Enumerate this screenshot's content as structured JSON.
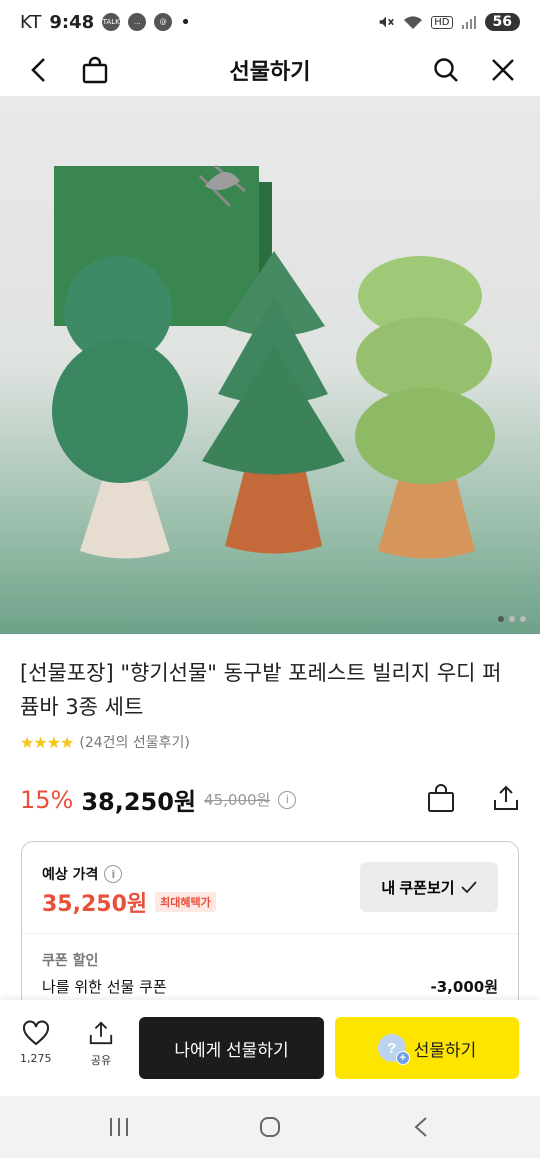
{
  "status_bar": {
    "carrier": "KT",
    "time": "9:48",
    "notif_talk": "TALK",
    "battery": "56"
  },
  "header": {
    "title": "선물하기"
  },
  "product": {
    "name": "[선물포장] \"향기선물\" 동구밭 포레스트 빌리지 우디 퍼퓸바 3종 세트",
    "stars": "★★★★",
    "review_count": "(24건의 선물후기)",
    "discount": "15%",
    "price": "38,250원",
    "original_price": "45,000원",
    "image_page": 1,
    "image_pages": 3
  },
  "estimate": {
    "label": "예상 가격",
    "price": "35,250원",
    "badge": "최대혜택가",
    "coupon_button": "내 쿠폰보기",
    "coupon_section": "쿠폰 할인",
    "coupon_name": "나를 위한 선물 쿠폰",
    "coupon_amount": "-3,000원"
  },
  "bottom": {
    "like_count": "1,275",
    "share_label": "공유",
    "self_gift": "나에게 선물하기",
    "gift": "선물하기"
  },
  "colors": {
    "accent_red": "#e8503a",
    "kakao_yellow": "#fee500",
    "dark_button": "#1c1c1c"
  }
}
